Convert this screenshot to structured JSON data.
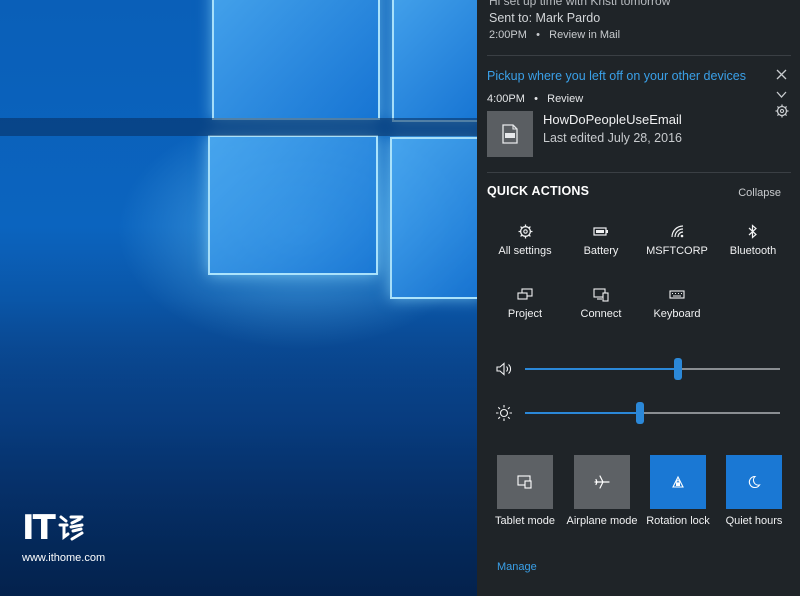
{
  "watermark": {
    "logo_text": "IT",
    "url": "www.ithome.com"
  },
  "notifications": {
    "email": {
      "clipped_text": "Hi set up time with Kristi tomorrow",
      "sent_to": "Sent to: Mark Pardo",
      "time": "2:00PM",
      "app": "Review in Mail"
    },
    "pickup": {
      "header": "Pickup where you left off on your other devices",
      "time": "4:00PM",
      "app": "Review",
      "file_name": "HowDoPeopleUseEmail",
      "file_edited": "Last edited July 28, 2016",
      "file_icon": "pdf-file-icon"
    }
  },
  "quick_actions": {
    "title": "QUICK ACTIONS",
    "collapse_label": "Collapse",
    "small_tiles": [
      {
        "label": "All settings",
        "icon": "gear-icon"
      },
      {
        "label": "Battery",
        "icon": "battery-icon"
      },
      {
        "label": "MSFTCORP",
        "icon": "wifi-icon"
      },
      {
        "label": "Bluetooth",
        "icon": "bluetooth-icon"
      },
      {
        "label": "Project",
        "icon": "project-icon"
      },
      {
        "label": "Connect",
        "icon": "connect-icon"
      },
      {
        "label": "Keyboard",
        "icon": "keyboard-icon"
      }
    ],
    "volume": {
      "icon": "speaker-icon",
      "level": 0.6
    },
    "brightness": {
      "icon": "sun-icon",
      "level": 0.45
    },
    "big_tiles": [
      {
        "label": "Tablet mode",
        "icon": "tablet-mode-icon",
        "state": "off"
      },
      {
        "label": "Airplane mode",
        "icon": "airplane-icon",
        "state": "off"
      },
      {
        "label": "Rotation lock",
        "icon": "rotation-lock-icon",
        "state": "on"
      },
      {
        "label": "Quiet hours",
        "icon": "moon-icon",
        "state": "on"
      }
    ],
    "manage_label": "Manage"
  },
  "colors": {
    "accent": "#1a78d4",
    "link": "#3aa0e8",
    "panel_bg": "#1f2428"
  }
}
